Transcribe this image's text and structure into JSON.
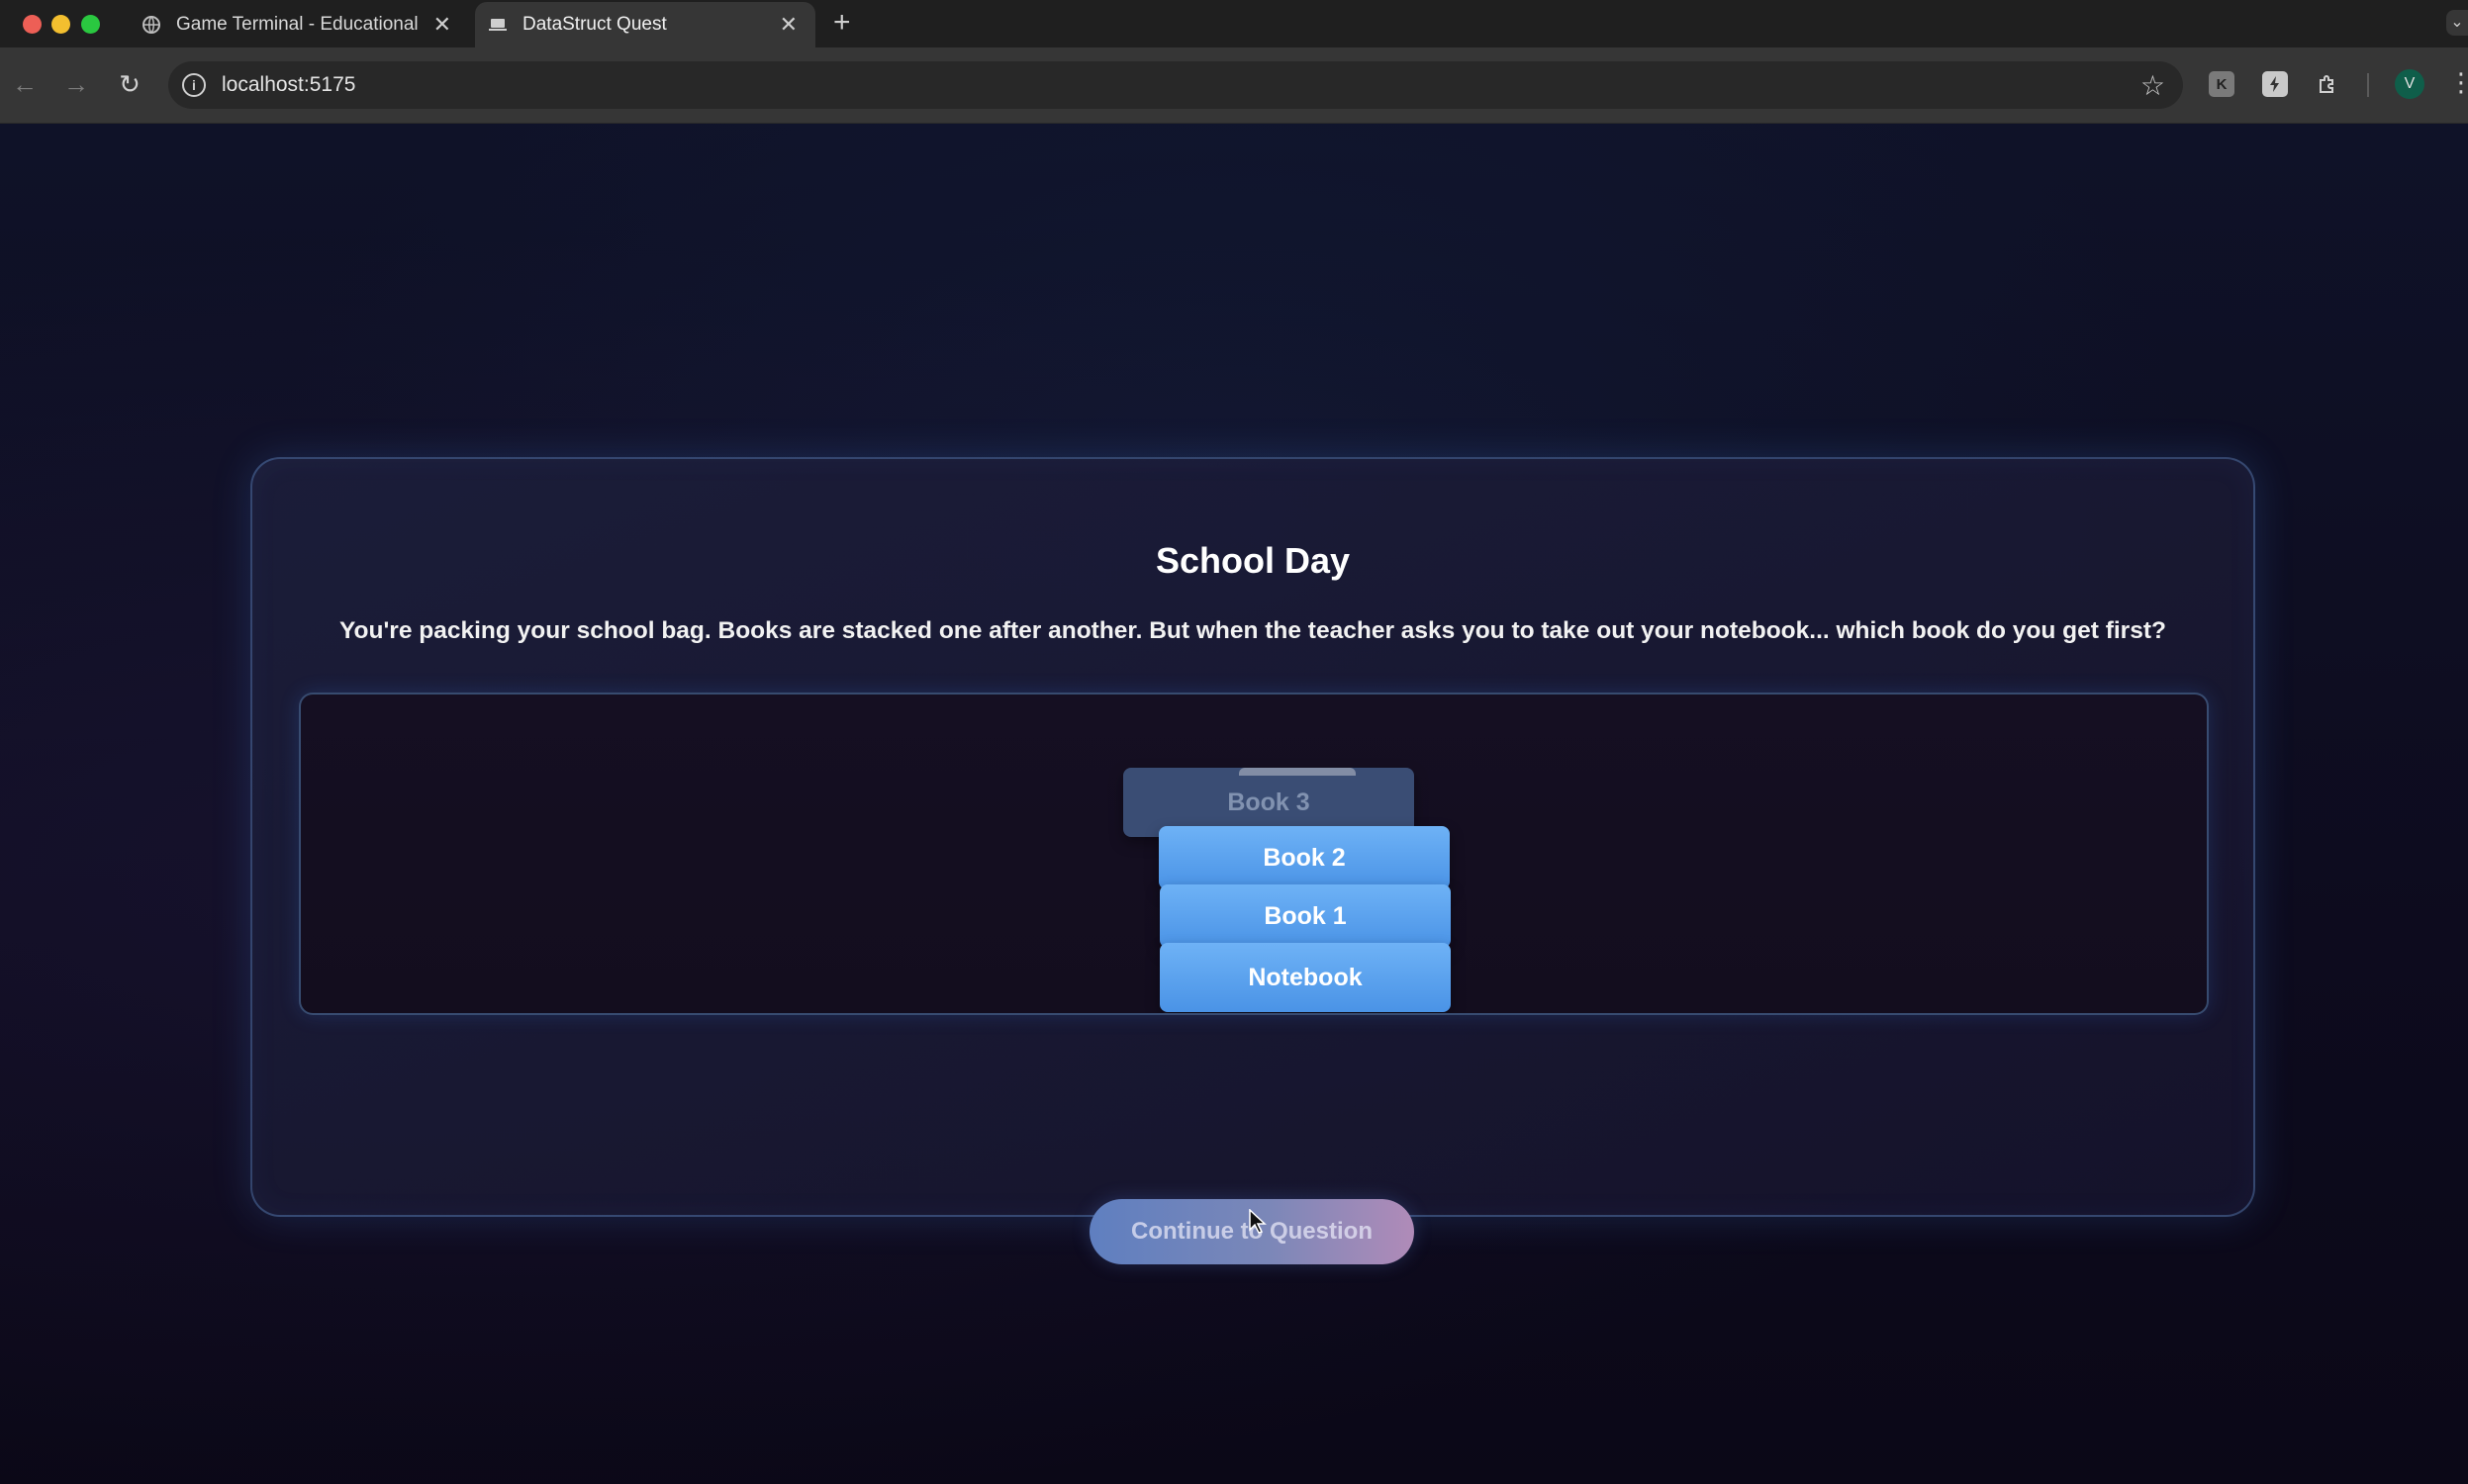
{
  "browser": {
    "tabs": [
      {
        "title": "Game Terminal - Educational",
        "active": false
      },
      {
        "title": "DataStruct Quest",
        "active": true
      }
    ],
    "url": "localhost:5175",
    "extensions": [
      "K"
    ],
    "profile_initial": "V"
  },
  "scene": {
    "title": "School Day",
    "prompt": "You're packing your school bag. Books are stacked one after another. But when the teacher asks you to take out your notebook... which book do you get first?",
    "stack": [
      {
        "label": "Book 3",
        "state": "being removed"
      },
      {
        "label": "Book 2"
      },
      {
        "label": "Book 1"
      },
      {
        "label": "Notebook"
      }
    ],
    "continue_label": "Continue to Question"
  },
  "colors": {
    "book_blue": "#5aa2f0",
    "card_border": "#6ea0e6",
    "button_gradient_start": "#5f7fc0",
    "button_gradient_end": "#b08bb8"
  }
}
